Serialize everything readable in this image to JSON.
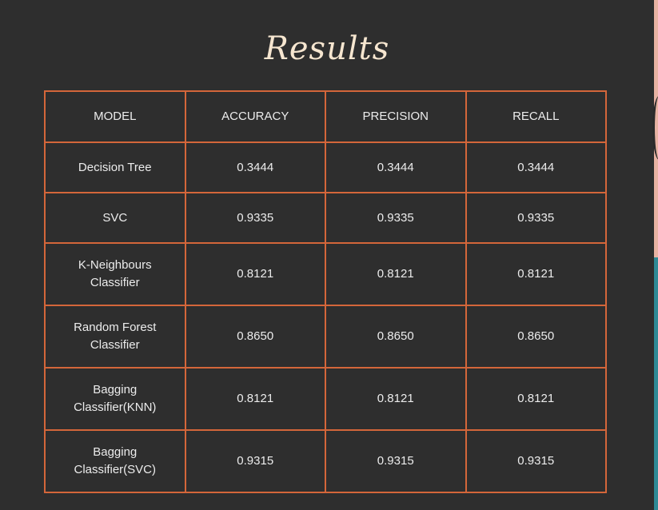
{
  "title": "Results",
  "columns": [
    "MODEL",
    "ACCURACY",
    "PRECISION",
    "RECALL"
  ],
  "rows": [
    {
      "model": "Decision Tree",
      "accuracy": "0.3444",
      "precision": "0.3444",
      "recall": "0.3444"
    },
    {
      "model": "SVC",
      "accuracy": "0.9335",
      "precision": "0.9335",
      "recall": "0.9335"
    },
    {
      "model_line1": "K-Neighbours",
      "model_line2": "Classifier",
      "accuracy": "0.8121",
      "precision": "0.8121",
      "recall": "0.8121"
    },
    {
      "model_line1": "Random Forest",
      "model_line2": "Classifier",
      "accuracy": "0.8650",
      "precision": "0.8650",
      "recall": "0.8650"
    },
    {
      "model_line1": "Bagging",
      "model_line2": "Classifier(KNN)",
      "accuracy": "0.8121",
      "precision": "0.8121",
      "recall": "0.8121"
    },
    {
      "model_line1": "Bagging",
      "model_line2": "Classifier(SVC)",
      "accuracy": "0.9315",
      "precision": "0.9315",
      "recall": "0.9315"
    }
  ],
  "colors": {
    "background": "#2e2e2e",
    "border": "#d4663a",
    "title": "#f6e6d0",
    "text": "#ececec",
    "accent_peach": "#e8b3a3",
    "accent_teal": "#2e8a96"
  }
}
